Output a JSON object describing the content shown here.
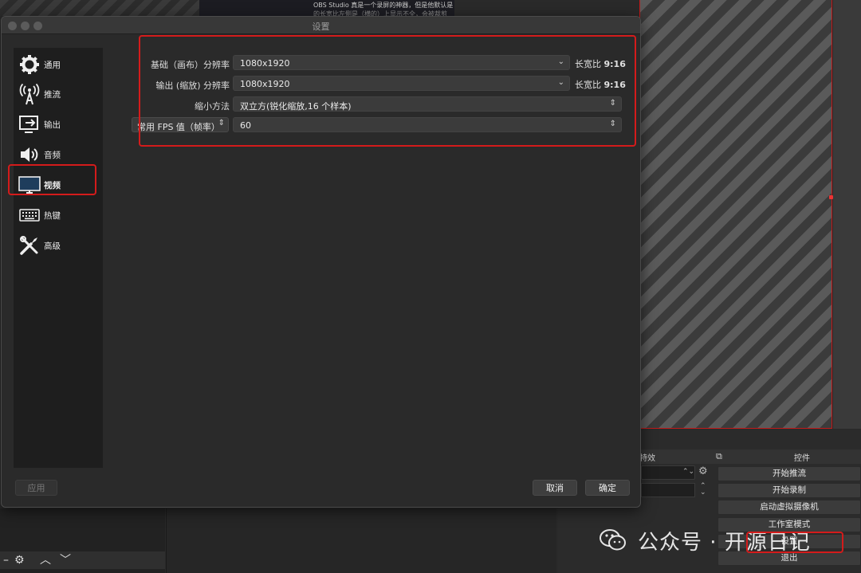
{
  "background": {
    "note_line1": "OBS Studio 真是一个录屏的神器，但是他默认是",
    "note_line2": "的长宽比左侧是（横的）上显示不全，会被裁剪",
    "dock": {
      "effects_label": "特效",
      "controls_label": "控件",
      "buttons": [
        "开始推流",
        "开始录制",
        "启动虚拟摄像机",
        "工作室模式",
        "设置",
        "退出"
      ]
    }
  },
  "watermark": {
    "text": "公众号 · 开源日记"
  },
  "dialog": {
    "title": "设置",
    "nav": [
      {
        "label": "通用",
        "icon": "gear-icon"
      },
      {
        "label": "推流",
        "icon": "broadcast-icon"
      },
      {
        "label": "输出",
        "icon": "output-icon"
      },
      {
        "label": "音频",
        "icon": "speaker-icon"
      },
      {
        "label": "视频",
        "icon": "monitor-icon",
        "active": true
      },
      {
        "label": "热键",
        "icon": "keyboard-icon"
      },
      {
        "label": "高级",
        "icon": "tools-icon"
      }
    ],
    "video": {
      "base_resolution": {
        "label": "基础（画布）分辨率",
        "value": "1080x1920",
        "aspect_label": "长宽比",
        "aspect_value": "9:16"
      },
      "output_resolution": {
        "label": "输出 (缩放) 分辨率",
        "value": "1080x1920",
        "aspect_label": "长宽比",
        "aspect_value": "9:16"
      },
      "downscale_filter": {
        "label": "缩小方法",
        "value": "双立方(锐化缩放,16 个样本)"
      },
      "fps": {
        "type_label": "常用 FPS 值（帧率）",
        "value": "60"
      }
    },
    "buttons": {
      "apply": "应用",
      "cancel": "取消",
      "ok": "确定"
    }
  },
  "colors": {
    "highlight": "#d41b1b",
    "dialog_bg": "#2a2a2a",
    "sidebar_bg": "#1e1e1e",
    "field_bg": "#3b3b3b"
  }
}
